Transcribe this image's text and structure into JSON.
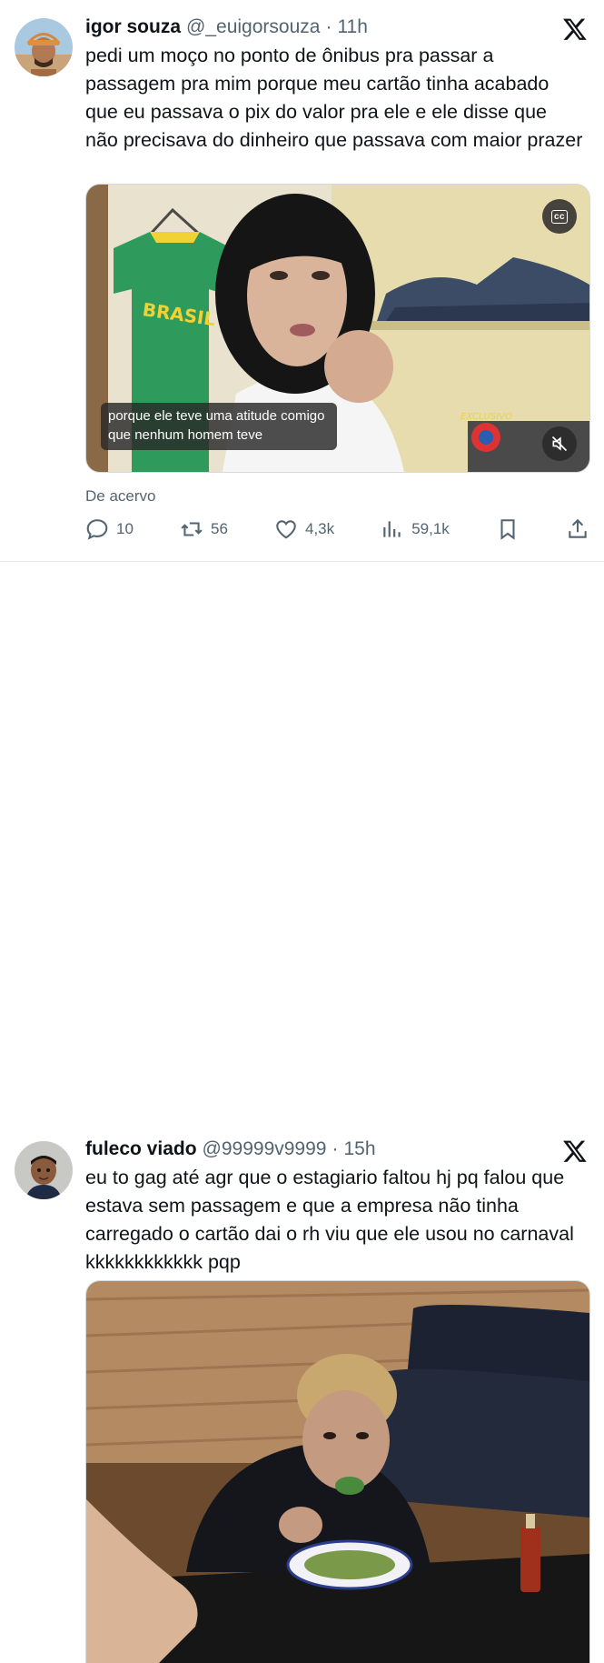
{
  "tweets": [
    {
      "author_name": "igor souza",
      "handle": "@_euigorsouza",
      "separator": "·",
      "time": "11h",
      "text": "pedi um moço no ponto de ônibus pra passar a passagem pra mim porque meu cartão tinha acabado que eu passava o pix do valor pra ele e ele disse que não precisava do dinheiro que passava com maior prazer",
      "video_caption_line1": "porque ele teve uma atitude comigo",
      "video_caption_line2": "que nenhum homem teve",
      "cc_label": "cc",
      "overlay_brand": "EXCLUSIVO",
      "shirt_text": "BRASIL",
      "source_label": "De acervo",
      "stats": {
        "replies": "10",
        "reposts": "56",
        "likes": "4,3k",
        "views": "59,1k"
      }
    },
    {
      "author_name": "fuleco viado",
      "handle": "@99999v9999",
      "separator": "·",
      "time": "15h",
      "text": "eu to gag até agr que o estagiario faltou hj pq falou que estava sem passagem e que a empresa não tinha carregado o cartão  dai o rh viu que ele usou no carnaval kkkkkkkkkkkk pqp"
    }
  ],
  "icons": {
    "x_logo": "x-logo-icon",
    "reply": "speech-bubble-icon",
    "repost": "repost-arrows-icon",
    "like": "heart-icon",
    "views": "bar-chart-icon",
    "bookmark": "bookmark-icon",
    "share": "share-upload-icon"
  },
  "colors": {
    "text_primary": "#0f1419",
    "text_secondary": "#536471",
    "divider": "#e6e9ec"
  }
}
